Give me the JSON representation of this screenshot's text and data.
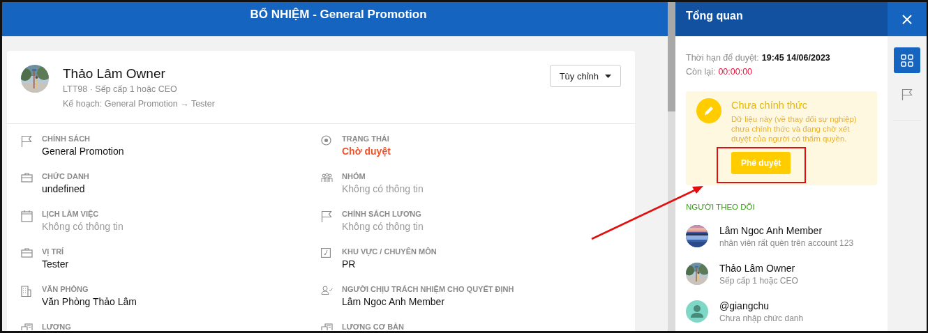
{
  "header": {
    "title": "BỔ NHIỆM - General Promotion"
  },
  "profile": {
    "name": "Thảo Lâm Owner",
    "subtitle": "LTT98 · Sếp cấp 1 hoặc CEO",
    "plan": "Kế hoạch: General Promotion → Tester",
    "customize_button": "Tùy chỉnh"
  },
  "fields_left": [
    {
      "label": "CHÍNH SÁCH",
      "value": "General Promotion",
      "kind": "text"
    },
    {
      "label": "CHỨC DANH",
      "value": "undefined",
      "kind": "text"
    },
    {
      "label": "LỊCH LÀM VIỆC",
      "value": "Không có thông tin",
      "kind": "empty"
    },
    {
      "label": "VỊ TRÍ",
      "value": "Tester",
      "kind": "text"
    },
    {
      "label": "VĂN PHÒNG",
      "value": "Văn Phòng Thảo Lâm",
      "kind": "text"
    },
    {
      "label": "LƯƠNG"
    }
  ],
  "fields_right": [
    {
      "label": "TRẠNG THÁI",
      "value": "Chờ duyệt",
      "kind": "status"
    },
    {
      "label": "NHÓM",
      "value": "Không có thông tin",
      "kind": "empty"
    },
    {
      "label": "CHÍNH SÁCH LƯƠNG",
      "value": "Không có thông tin",
      "kind": "empty"
    },
    {
      "label": "KHU VỰC / CHUYÊN MÔN",
      "value": "PR",
      "kind": "text"
    },
    {
      "label": "NGƯỜI CHỊU TRÁCH NHIỆM CHO QUYẾT ĐỊNH",
      "value": "Lâm Ngoc Anh Member",
      "kind": "text"
    },
    {
      "label": "LƯƠNG CƠ BẢN"
    }
  ],
  "overview": {
    "title": "Tổng quan",
    "deadline_label": "Thời hạn để duyệt:",
    "deadline_value": "19:45 14/06/2023",
    "remaining_label": "Còn lại:",
    "remaining_value": "00:00:00",
    "notice": {
      "title": "Chưa chính thức",
      "text": "Dữ liệu này (về thay đổi sự nghiệp) chưa chính thức và đang chờ xét duyệt của người có thẩm quyền.",
      "button": "Phê duyệt"
    },
    "followers_title": "NGƯỜI THEO DÕI",
    "followers": [
      {
        "name": "Lâm Ngoc Anh Member",
        "subtitle": "nhân viên rất quèn trên account 123"
      },
      {
        "name": "Thảo Lâm Owner",
        "subtitle": "Sếp cấp 1 hoặc CEO"
      },
      {
        "name": "@giangchu",
        "subtitle": "Chưa nhập chức danh",
        "avatar": {
          "kind": "placeholder"
        }
      }
    ]
  },
  "rail": [
    {
      "kind": "grid",
      "selected": true
    },
    {
      "kind": "flag",
      "selected": false
    }
  ],
  "annotations": {
    "highlight_box": true,
    "arrow": true
  }
}
